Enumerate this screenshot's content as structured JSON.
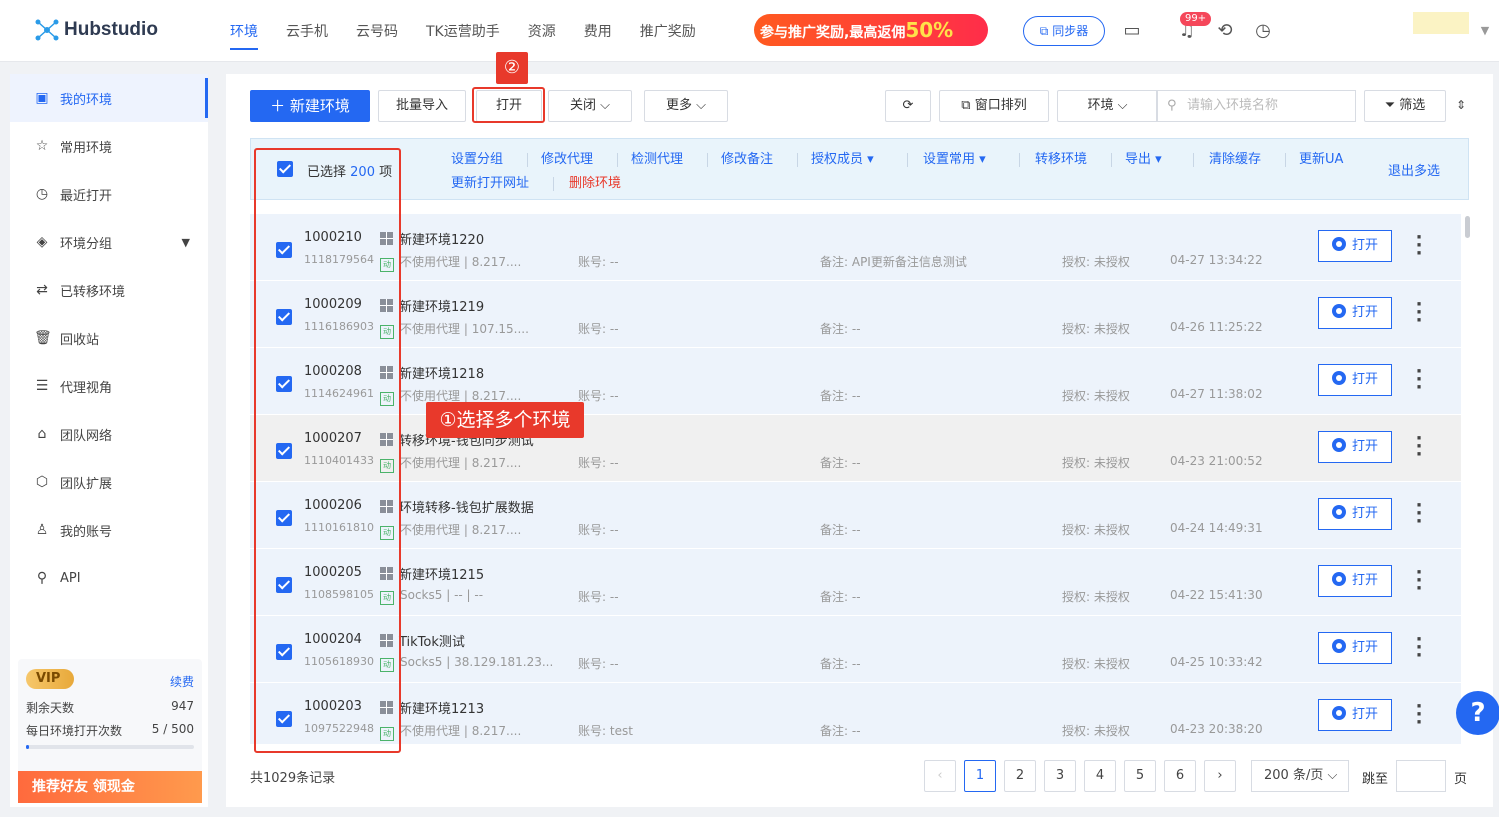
{
  "brand": {
    "name": "Hubstudio"
  },
  "nav": [
    "环境",
    "云手机",
    "云号码",
    "TK运营助手",
    "资源",
    "费用",
    "推广奖励"
  ],
  "promo": {
    "text": "参与推广奖励,最高返佣",
    "percent": "50%"
  },
  "header": {
    "sync_label": "同步器",
    "notice_badge": "99+"
  },
  "sidebar": {
    "items": [
      {
        "label": "我的环境",
        "icon": "browser-icon"
      },
      {
        "label": "常用环境",
        "icon": "star-icon"
      },
      {
        "label": "最近打开",
        "icon": "clock-icon"
      },
      {
        "label": "环境分组",
        "icon": "layers-icon"
      },
      {
        "label": "已转移环境",
        "icon": "transfer-icon"
      },
      {
        "label": "回收站",
        "icon": "trash-icon"
      },
      {
        "label": "代理视角",
        "icon": "proxy-icon"
      },
      {
        "label": "团队网络",
        "icon": "network-icon"
      },
      {
        "label": "团队扩展",
        "icon": "extension-icon"
      },
      {
        "label": "我的账号",
        "icon": "user-icon"
      },
      {
        "label": "API",
        "icon": "api-icon"
      }
    ],
    "vip": {
      "tag": "VIP",
      "renew": "续费",
      "days_label": "剩余天数",
      "days": "947",
      "opens_label": "每日环境打开次数",
      "opens": "5 / 500",
      "opens_fraction": 0.01,
      "recommend": "推荐好友 领现金"
    }
  },
  "toolbar": {
    "new_env": "新建环境",
    "batch_import": "批量导入",
    "open": "打开",
    "close": "关闭",
    "more": "更多",
    "arrange": "窗口排列",
    "filter_type": "环境",
    "search_placeholder": "请输入环境名称",
    "filter": "筛选"
  },
  "annotations": {
    "step2": "②",
    "step1": "①选择多个环境"
  },
  "bulk": {
    "selected_prefix": "已选择",
    "selected_count": "200",
    "selected_suffix": "项",
    "actions": [
      "设置分组",
      "修改代理",
      "检测代理",
      "修改备注",
      "授权成员",
      "设置常用",
      "转移环境",
      "导出",
      "清除缓存",
      "更新UA"
    ],
    "actions_row2": [
      "更新打开网址",
      "删除环境"
    ],
    "exit": "退出多选"
  },
  "rows": [
    {
      "id": "1000210",
      "sub": "1118179564",
      "name": "新建环境1220",
      "proxy": "不使用代理",
      "ip": "8.217....",
      "account": "账号: --",
      "note": "备注: API更新备注信息测试",
      "auth": "授权: 未授权",
      "time": "04-27 13:34:22",
      "open": "打开"
    },
    {
      "id": "1000209",
      "sub": "1116186903",
      "name": "新建环境1219",
      "proxy": "不使用代理",
      "ip": "107.15....",
      "account": "账号: --",
      "note": "备注: --",
      "auth": "授权: 未授权",
      "time": "04-26 11:25:22",
      "open": "打开"
    },
    {
      "id": "1000208",
      "sub": "1114624961",
      "name": "新建环境1218",
      "proxy": "不使用代理",
      "ip": "8.217....",
      "account": "账号: --",
      "note": "备注: --",
      "auth": "授权: 未授权",
      "time": "04-27 11:38:02",
      "open": "打开"
    },
    {
      "id": "1000207",
      "sub": "1110401433",
      "name": "转移环境-钱包同步测试",
      "proxy": "不使用代理",
      "ip": "8.217....",
      "account": "账号: --",
      "note": "备注: --",
      "auth": "授权: 未授权",
      "time": "04-23 21:00:52",
      "open": "打开"
    },
    {
      "id": "1000206",
      "sub": "1110161810",
      "name": "环境转移-钱包扩展数据",
      "proxy": "不使用代理",
      "ip": "8.217....",
      "account": "账号: --",
      "note": "备注: --",
      "auth": "授权: 未授权",
      "time": "04-24 14:49:31",
      "open": "打开"
    },
    {
      "id": "1000205",
      "sub": "1108598105",
      "name": "新建环境1215",
      "proxy": "Socks5",
      "ip": "--  |  --",
      "account": "账号: --",
      "note": "备注: --",
      "auth": "授权: 未授权",
      "time": "04-22 15:41:30",
      "open": "打开"
    },
    {
      "id": "1000204",
      "sub": "1105618930",
      "name": "TikTok测试",
      "proxy": "Socks5",
      "ip": "38.129.181.23...",
      "account": "账号: --",
      "note": "备注: --",
      "auth": "授权: 未授权",
      "time": "04-25 10:33:42",
      "open": "打开"
    },
    {
      "id": "1000203",
      "sub": "1097522948",
      "name": "新建环境1213",
      "proxy": "不使用代理",
      "ip": "8.217....",
      "account": "账号: test",
      "note": "备注: --",
      "auth": "授权: 未授权",
      "time": "04-23 20:38:20",
      "open": "打开"
    }
  ],
  "pagination": {
    "total": "共1029条记录",
    "pages": [
      "1",
      "2",
      "3",
      "4",
      "5",
      "6"
    ],
    "size": "200 条/页",
    "jump_label": "跳至",
    "page_suffix": "页"
  },
  "colors": {
    "primary": "#2468f2",
    "annotation": "#e8392b"
  }
}
